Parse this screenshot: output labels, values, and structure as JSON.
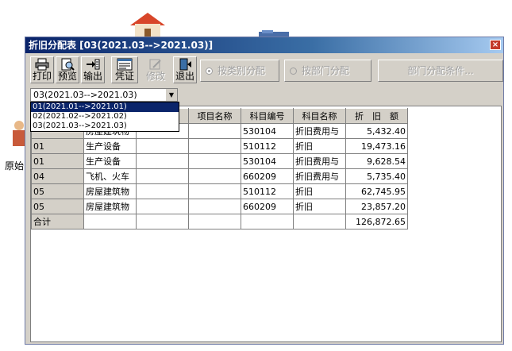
{
  "desktop": {
    "icon_label": "原始"
  },
  "window": {
    "title": "折旧分配表 [03(2021.03-->2021.03)]",
    "close_glyph": "×"
  },
  "toolbar": {
    "print": "打印",
    "preview": "预览",
    "export": "输出",
    "voucher": "凭证",
    "modify": "修改",
    "exit": "退出",
    "by_category": "按类别分配",
    "by_department": "按部门分配",
    "dept_conditions": "部门分配条件..."
  },
  "period_select": {
    "value": "03(2021.03-->2021.03)",
    "options": [
      "01(2021.01-->2021.01)",
      "02(2021.02-->2021.02)",
      "03(2021.03-->2021.03)"
    ],
    "highlighted_index": 0
  },
  "table": {
    "headers": [
      "",
      "",
      "",
      "项目名称",
      "科目编号",
      "科目名称",
      "折　旧　额"
    ],
    "rows": [
      [
        "",
        "房屋建筑物",
        "",
        "",
        "530104",
        "折旧费用与",
        "5,432.40"
      ],
      [
        "01",
        "生产设备",
        "",
        "",
        "510112",
        "折旧",
        "19,473.16"
      ],
      [
        "01",
        "生产设备",
        "",
        "",
        "530104",
        "折旧费用与",
        "9,628.54"
      ],
      [
        "04",
        "飞机、火车",
        "",
        "",
        "660209",
        "折旧费用与",
        "5,735.40"
      ],
      [
        "05",
        "房屋建筑物",
        "",
        "",
        "510112",
        "折旧",
        "62,745.95"
      ],
      [
        "05",
        "房屋建筑物",
        "",
        "",
        "660209",
        "折旧",
        "23,857.20"
      ]
    ],
    "total_label": "合计",
    "total_value": "126,872.65"
  },
  "icons": {
    "print": "printer-icon",
    "preview": "magnifier-icon",
    "export": "export-icon",
    "voucher": "voucher-icon",
    "modify": "edit-icon",
    "exit": "exit-door-icon"
  },
  "colors": {
    "titlebar_start": "#0a246a",
    "titlebar_end": "#a6caf0",
    "close_button": "#c43a2a",
    "selection": "#0a246a",
    "window_face": "#d4d0c8"
  }
}
